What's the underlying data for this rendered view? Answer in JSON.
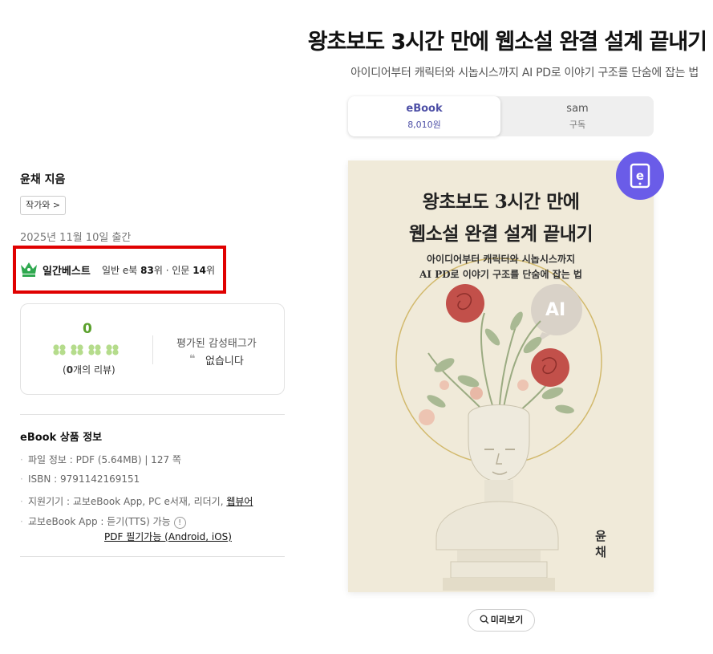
{
  "book": {
    "title": "왕초보도 3시간 만에 웹소설 완결 설계 끝내기",
    "subtitle": "아이디어부터 캐릭터와 시놉시스까지 AI PD로 이야기 구조를 단숨에 잡는 법"
  },
  "tabs": [
    {
      "label": "eBook",
      "sub": "8,010원",
      "active": true
    },
    {
      "label": "sam",
      "sub": "구독",
      "active": false
    }
  ],
  "author": {
    "name": "윤채 지음",
    "button": "작가와 >"
  },
  "pubdate": "2025년 11월 10일 출간",
  "bestseller": {
    "label": "일간베스트",
    "rank_prefix": "일반 e북 ",
    "rank1": "83",
    "rank_mid": "위 · 인문 ",
    "rank2": "14",
    "rank_suffix": "위"
  },
  "review": {
    "score": "0",
    "count_prefix": "(",
    "count": "0",
    "count_suffix": "개의 리뷰)",
    "tag_label": "평가된 감성태그가",
    "tag_empty": "없습니다"
  },
  "info": {
    "title": "eBook 상품 정보",
    "file": "파일 정보 : PDF (5.64MB)   |  127 쪽",
    "isbn": "ISBN : 9791142169151",
    "devices_prefix": "지원기기 : 교보eBook App, PC e서재, 리더기, ",
    "devices_link": "웹뷰어",
    "app": "교보eBook App : 듣기(TTS) 가능",
    "pdf_note": "PDF 필기가능 (Android, iOS)"
  },
  "cover": {
    "line1": "왕초보도 3시간 만에",
    "line2": "웹소설 완결 설계 끝내기",
    "sub1": "아이디어부터 캐릭터와 시놉시스까지",
    "sub2": "AI PD로 이야기 구조를 단숨에 잡는 법",
    "ai": "AI",
    "author1": "윤",
    "author2": "채"
  },
  "preview": {
    "label": "미리보기"
  },
  "colors": {
    "accent": "#4d4fa6",
    "badge": "#6a5ce8",
    "highlight_box": "#e00000",
    "crown": "#2fa84f",
    "score": "#5aa02c",
    "clover": "#b5dc8c"
  },
  "icons": [
    "crown-icon",
    "clover-icon",
    "help-icon",
    "ebook-icon",
    "search-icon"
  ]
}
